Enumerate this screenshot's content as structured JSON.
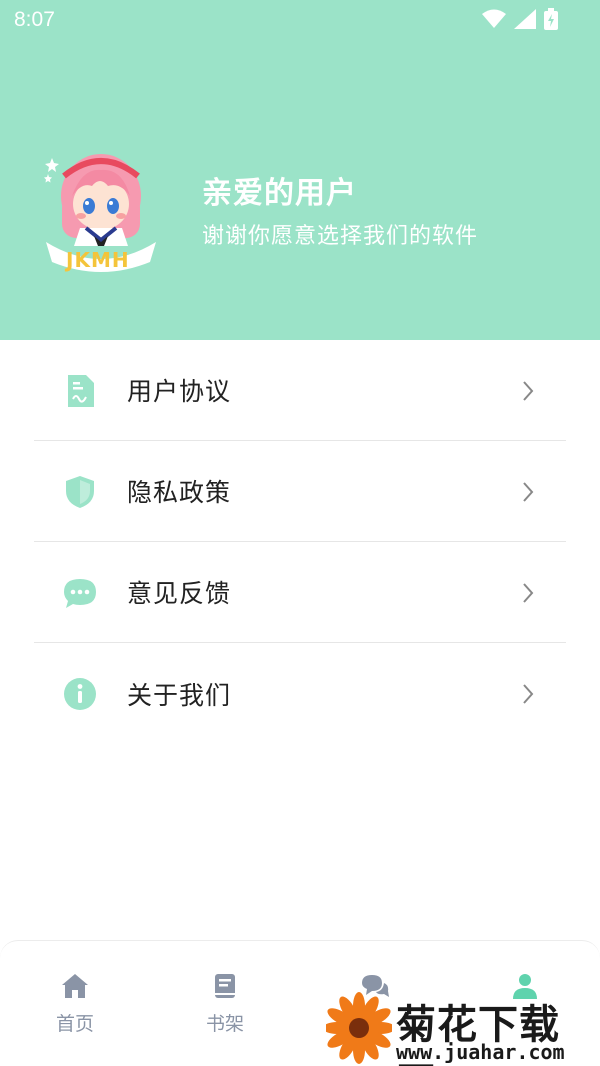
{
  "status_bar": {
    "time": "8:07"
  },
  "profile": {
    "avatar_badge": "JKMH",
    "name": "亲爱的用户",
    "subtitle": "谢谢你愿意选择我们的软件"
  },
  "menu": [
    {
      "label": "用户协议",
      "icon": "document-icon"
    },
    {
      "label": "隐私政策",
      "icon": "shield-icon"
    },
    {
      "label": "意见反馈",
      "icon": "chat-bubble-icon"
    },
    {
      "label": "关于我们",
      "icon": "info-icon"
    }
  ],
  "tabs": [
    {
      "label": "首页",
      "icon": "home-icon",
      "active": false
    },
    {
      "label": "书架",
      "icon": "book-icon",
      "active": false
    },
    {
      "label": "",
      "icon": "chat-icon",
      "active": false
    },
    {
      "label": "",
      "icon": "user-icon",
      "active": true
    }
  ],
  "watermark": {
    "title": "菊花下载网",
    "url": "www.juahar.com"
  },
  "colors": {
    "accent": "#9be3c8",
    "accent_dark": "#5fd3ad",
    "tab_inactive": "#8a94a6"
  }
}
